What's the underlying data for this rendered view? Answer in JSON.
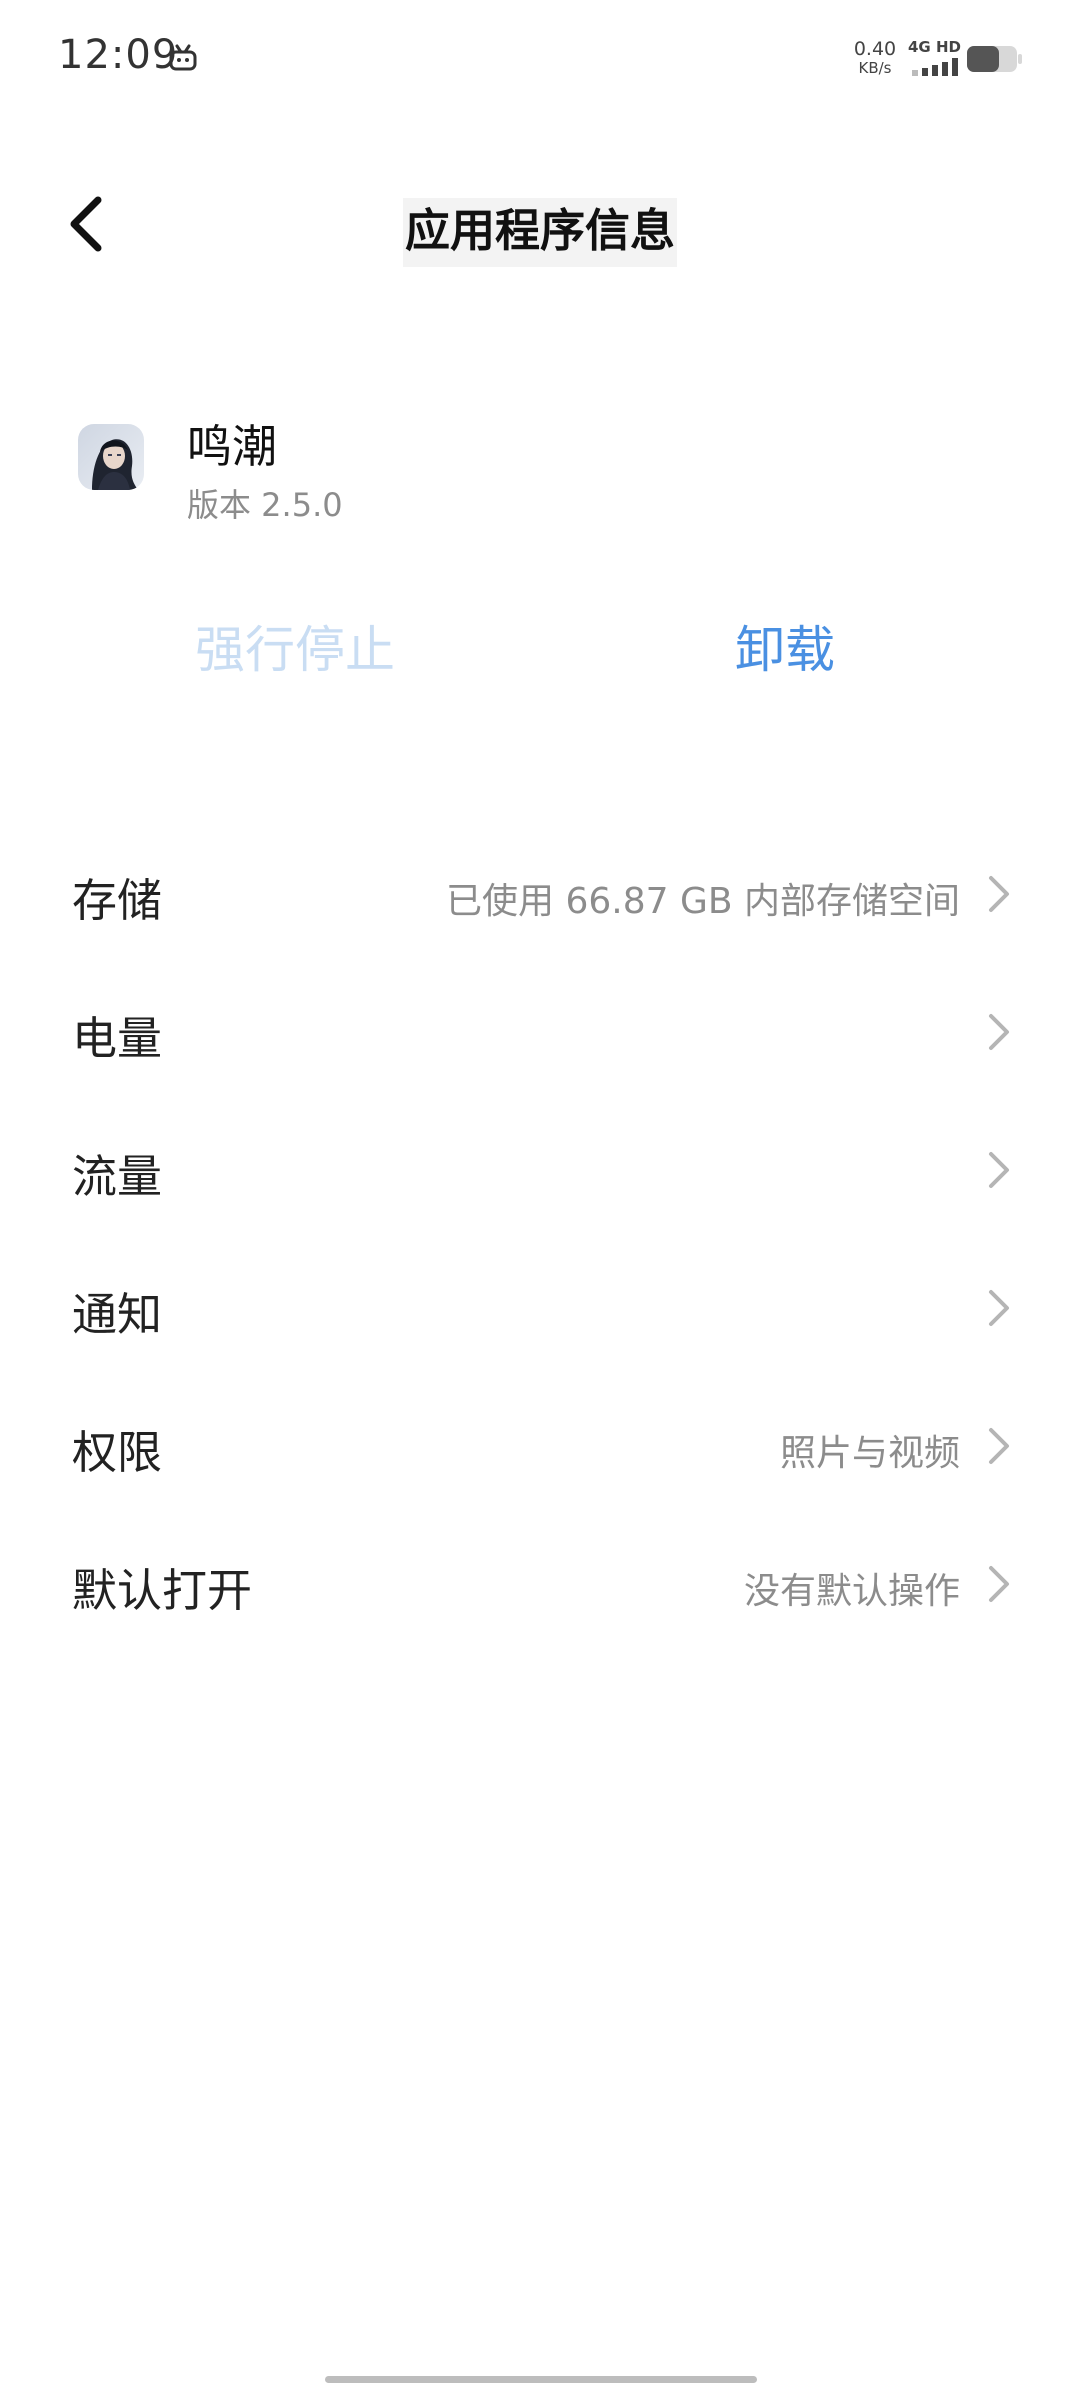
{
  "status_bar": {
    "time": "12:09",
    "app_icon": "tv-icon",
    "speed_value": "0.40",
    "speed_unit": "KB/s",
    "network": "4G HD",
    "battery_icon": "battery-icon"
  },
  "header": {
    "title": "应用程序信息",
    "back_icon": "back-arrow-icon"
  },
  "app": {
    "name": "鸣潮",
    "version": "版本 2.5.0",
    "icon": "app-icon-wuthering-waves"
  },
  "actions": {
    "force_stop": "强行停止",
    "uninstall": "卸载"
  },
  "settings": {
    "items": [
      {
        "label": "存储",
        "value": "已使用 66.87 GB 内部存储空间"
      },
      {
        "label": "电量",
        "value": ""
      },
      {
        "label": "流量",
        "value": ""
      },
      {
        "label": "通知",
        "value": ""
      },
      {
        "label": "权限",
        "value": "照片与视频"
      },
      {
        "label": "默认打开",
        "value": "没有默认操作"
      }
    ]
  },
  "colors": {
    "accent": "#4a90e2",
    "disabled": "#c9ddf3",
    "secondary_text": "#8c8c8c",
    "chevron": "#b5b5b5"
  }
}
